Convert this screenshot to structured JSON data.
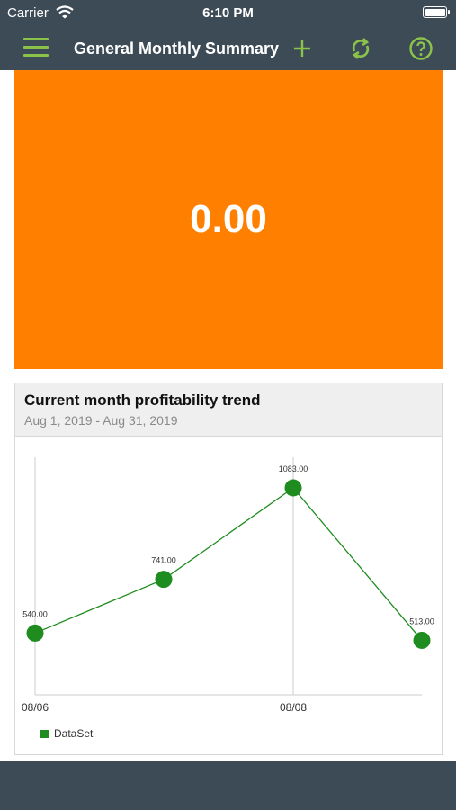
{
  "status_bar": {
    "carrier": "Carrier",
    "time": "6:10 PM"
  },
  "nav": {
    "title": "General Monthly Summary",
    "accent_color": "#8bc34a",
    "icons": [
      "menu-icon",
      "add-icon",
      "refresh-icon",
      "help-icon"
    ]
  },
  "kpi": {
    "value": "0.00",
    "color": "#ff8000"
  },
  "chart_card": {
    "title": "Current month profitability trend",
    "subtitle": "Aug 1, 2019 - Aug 31, 2019"
  },
  "chart_data": {
    "type": "line",
    "series": [
      {
        "name": "DataSet",
        "color": "#1e8c1e",
        "values": [
          540.0,
          741.0,
          1083.0,
          513.0
        ],
        "labels": [
          "540.00",
          "741.00",
          "1083.00",
          "513.00"
        ]
      }
    ],
    "x_tick_labels": [
      "08/06",
      "08/08"
    ],
    "legend_position": "bottom-left",
    "grid": "vertical lines at labeled ticks"
  }
}
